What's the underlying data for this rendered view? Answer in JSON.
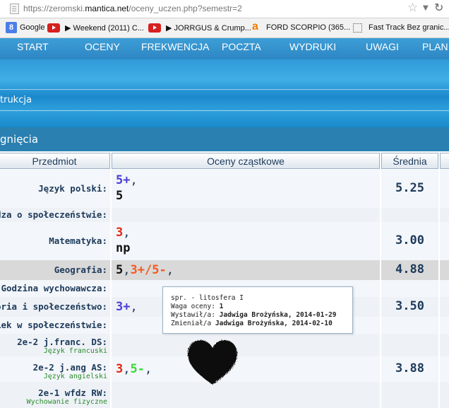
{
  "browser": {
    "url_prefix": "https://zeromski.",
    "url_domain": "mantica.net",
    "url_suffix": "/oceny_uczen.php?semestr=2"
  },
  "bookmarks": [
    {
      "label": "Google",
      "icon": "google-icon"
    },
    {
      "label": "",
      "icon": "youtube-icon"
    },
    {
      "label": "▶ Weekend (2011) C...",
      "icon": ""
    },
    {
      "label": "",
      "icon": "youtube-icon"
    },
    {
      "label": "▶ JORRGUS & Crump...",
      "icon": ""
    },
    {
      "label": "FORD SCORPIO (365...",
      "icon": "a-icon"
    },
    {
      "label": "Fast Track Bez granic...",
      "icon": "folder-icon"
    }
  ],
  "nav": [
    "START",
    "OCENY",
    "FREKWENCJA",
    "POCZTA",
    "WYDRUKI",
    "UWAGI",
    "PLAN"
  ],
  "banner_text": "trukcja",
  "section_title": "gnięcia",
  "table": {
    "headers": {
      "subject": "Przedmiot",
      "grades": "Oceny cząstkowe",
      "average": "Średnia"
    },
    "rows": [
      {
        "subject": "Język polski:",
        "grades": [
          [
            "5+",
            ","
          ],
          [
            "5",
            ""
          ]
        ],
        "average": "5.25"
      },
      {
        "subject": "edza o społeczeństwie:",
        "grades": [],
        "average": ""
      },
      {
        "subject": "Matematyka:",
        "grades": [
          [
            "3",
            ","
          ],
          [
            "np",
            ""
          ]
        ],
        "average": "3.00"
      },
      {
        "subject": "Geografia:",
        "grades": [
          [
            "5",
            ","
          ],
          [
            "3+/5-",
            ","
          ]
        ],
        "average": "4.88"
      },
      {
        "subject": "Godzina wychowawcza:",
        "grades": [],
        "average": ""
      },
      {
        "subject": "istoria i społeczeństwo:",
        "grades": [
          [
            "3+",
            ","
          ]
        ],
        "average": "3.50"
      },
      {
        "subject": "wiek w społeczeństwie:",
        "grades": [],
        "average": ""
      },
      {
        "subject": "2e-2 j.franc. DS:",
        "subtitle": "Język francuski",
        "grades": [],
        "average": ""
      },
      {
        "subject": "2e-2 j.ang AS:",
        "subtitle": "Język angielski",
        "grades": [
          [
            "3",
            ","
          ],
          [
            "5-",
            ","
          ]
        ],
        "average": "3.88"
      },
      {
        "subject": "2e-1 wfdz RW:",
        "subtitle": "Wychowanie fizyczne",
        "grades": [],
        "average": ""
      }
    ]
  },
  "tooltip": {
    "line1": "spr. - litosfera I",
    "line2_label": "Waga oceny:",
    "line2_value": "1",
    "line3_label": "Wystawił/a:",
    "line3_value": "Jadwiga Brożyńska, 2014-01-29",
    "line4_label": "Zmieniał/a",
    "line4_value": "Jadwiga Brożyńska, 2014-02-10"
  },
  "colors": {
    "nav_bg": "#3d9ed6",
    "section_bg": "#2a80b0",
    "grade_blue": "#4a3ed8",
    "grade_red": "#e02a10",
    "grade_green": "#38d838",
    "grade_orange": "#f45a20"
  }
}
